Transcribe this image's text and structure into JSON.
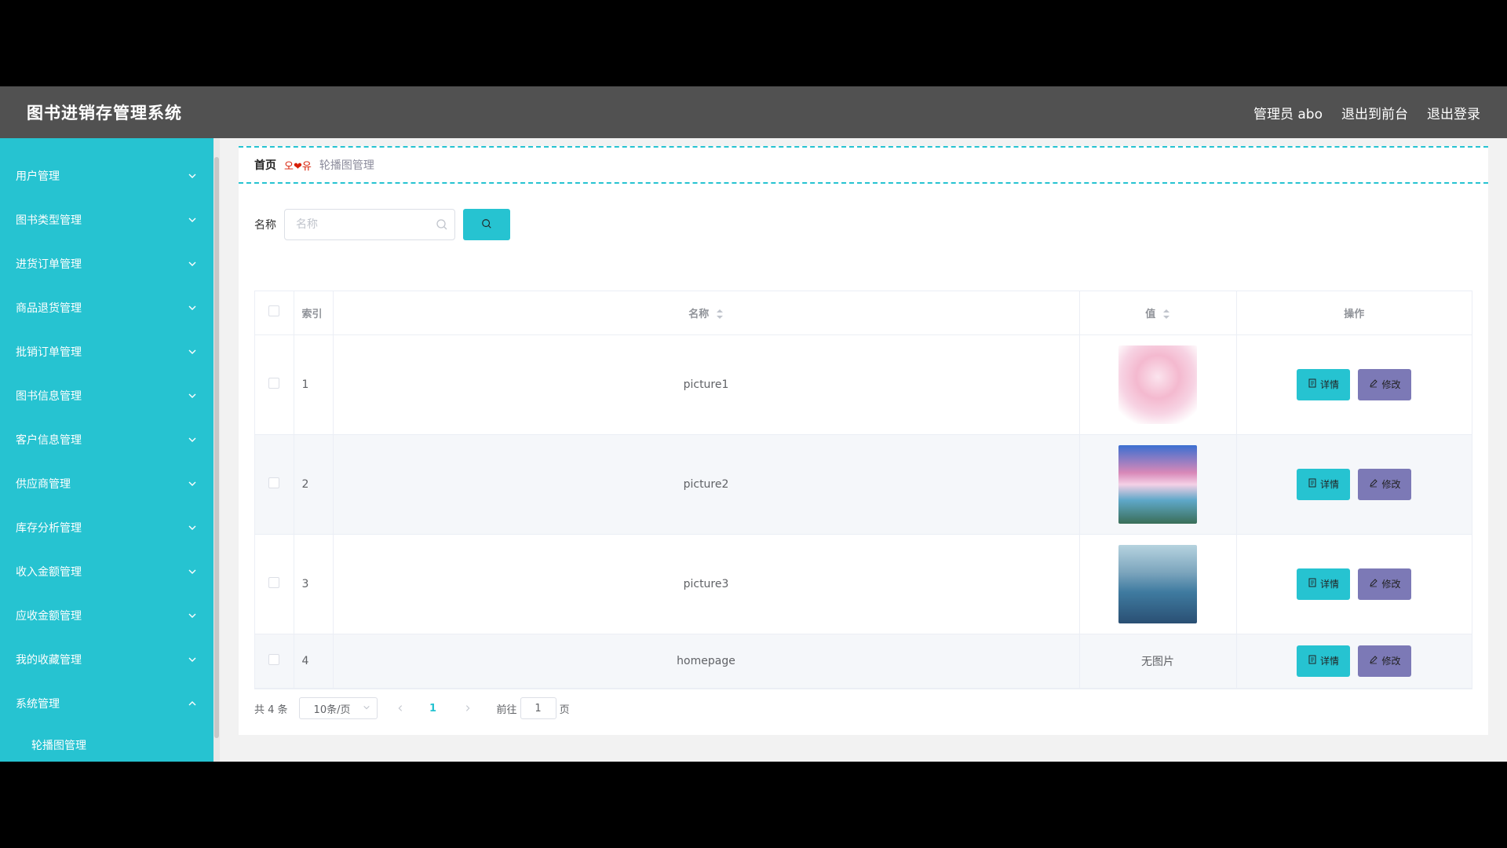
{
  "header": {
    "app_title": "图书进销存管理系统",
    "admin_label": "管理员 abo",
    "exit_to_front": "退出到前台",
    "logout": "退出登录"
  },
  "sidebar": {
    "items": [
      {
        "label": "用户管理"
      },
      {
        "label": "图书类型管理"
      },
      {
        "label": "进货订单管理"
      },
      {
        "label": "商品退货管理"
      },
      {
        "label": "批销订单管理"
      },
      {
        "label": "图书信息管理"
      },
      {
        "label": "客户信息管理"
      },
      {
        "label": "供应商管理"
      },
      {
        "label": "库存分析管理"
      },
      {
        "label": "收入金额管理"
      },
      {
        "label": "应收金额管理"
      },
      {
        "label": "我的收藏管理"
      },
      {
        "label": "系统管理"
      }
    ],
    "submenu": {
      "label": "轮播图管理"
    }
  },
  "breadcrumb": {
    "home": "首页",
    "separator": "오❤유",
    "current": "轮播图管理"
  },
  "search": {
    "label": "名称",
    "placeholder": "名称"
  },
  "table": {
    "headers": {
      "index": "索引",
      "name": "名称",
      "value": "值",
      "ops": "操作"
    },
    "rows": [
      {
        "index": "1",
        "name": "picture1",
        "value": ""
      },
      {
        "index": "2",
        "name": "picture2",
        "value": ""
      },
      {
        "index": "3",
        "name": "picture3",
        "value": ""
      },
      {
        "index": "4",
        "name": "homepage",
        "value": "无图片"
      }
    ],
    "detail_label": "详情",
    "edit_label": "修改"
  },
  "pagination": {
    "total": "共 4 条",
    "page_size": "10条/页",
    "current_page": "1",
    "goto_label": "前往",
    "goto_value": "1",
    "page_unit": "页"
  },
  "colors": {
    "accent": "#26c3d1",
    "edit_button": "#7c79b6",
    "topbar": "#515151"
  }
}
